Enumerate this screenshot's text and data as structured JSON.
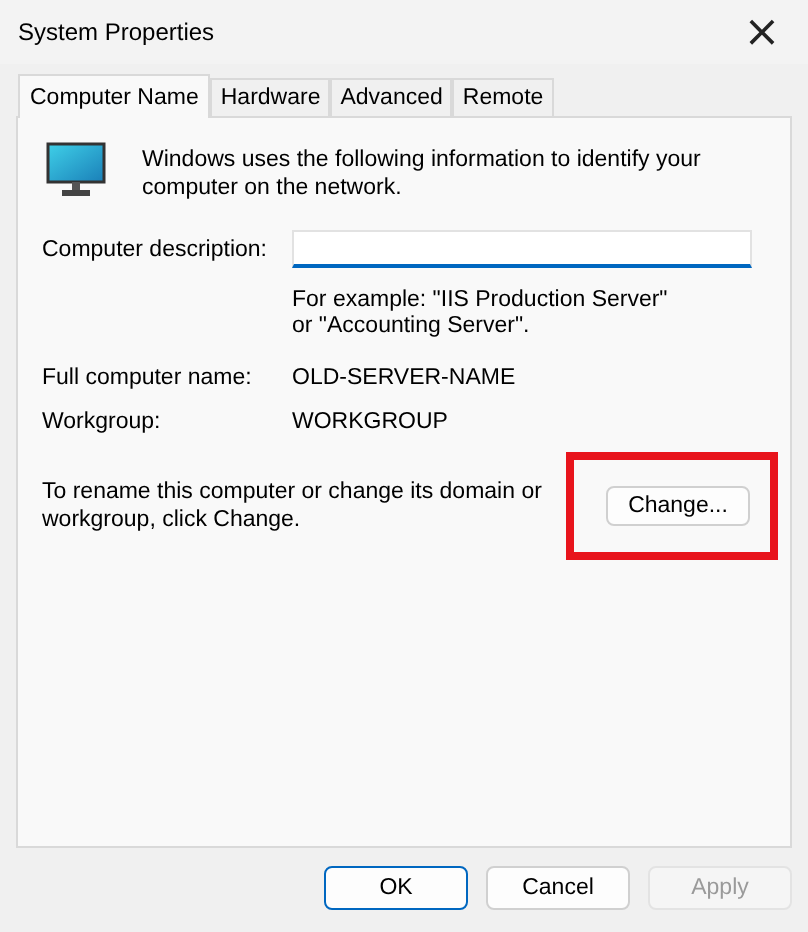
{
  "window": {
    "title": "System Properties",
    "close": "×"
  },
  "tabs": [
    {
      "label": "Computer Name",
      "selected": true
    },
    {
      "label": "Hardware",
      "selected": false
    },
    {
      "label": "Advanced",
      "selected": false
    },
    {
      "label": "Remote",
      "selected": false
    }
  ],
  "intro": "Windows uses the following information to identify your computer on the network.",
  "description": {
    "label": "Computer description:",
    "focused": true,
    "hint": "For example: \"IIS Production Server\" or \"Accounting Server\"."
  },
  "fields": [
    {
      "label": "Full computer name:",
      "value": "OLD-SERVER-NAME"
    },
    {
      "label": "Workgroup:",
      "value": "WORKGROUP"
    }
  ],
  "rename": {
    "text": "To rename this computer or change its domain or workgroup, click Change.",
    "button": "Change...",
    "highlighted": true
  },
  "buttons": [
    {
      "label": "OK",
      "default": true,
      "disabled": false
    },
    {
      "label": "Cancel",
      "default": false,
      "disabled": false
    },
    {
      "label": "Apply",
      "default": false,
      "disabled": true
    }
  ]
}
